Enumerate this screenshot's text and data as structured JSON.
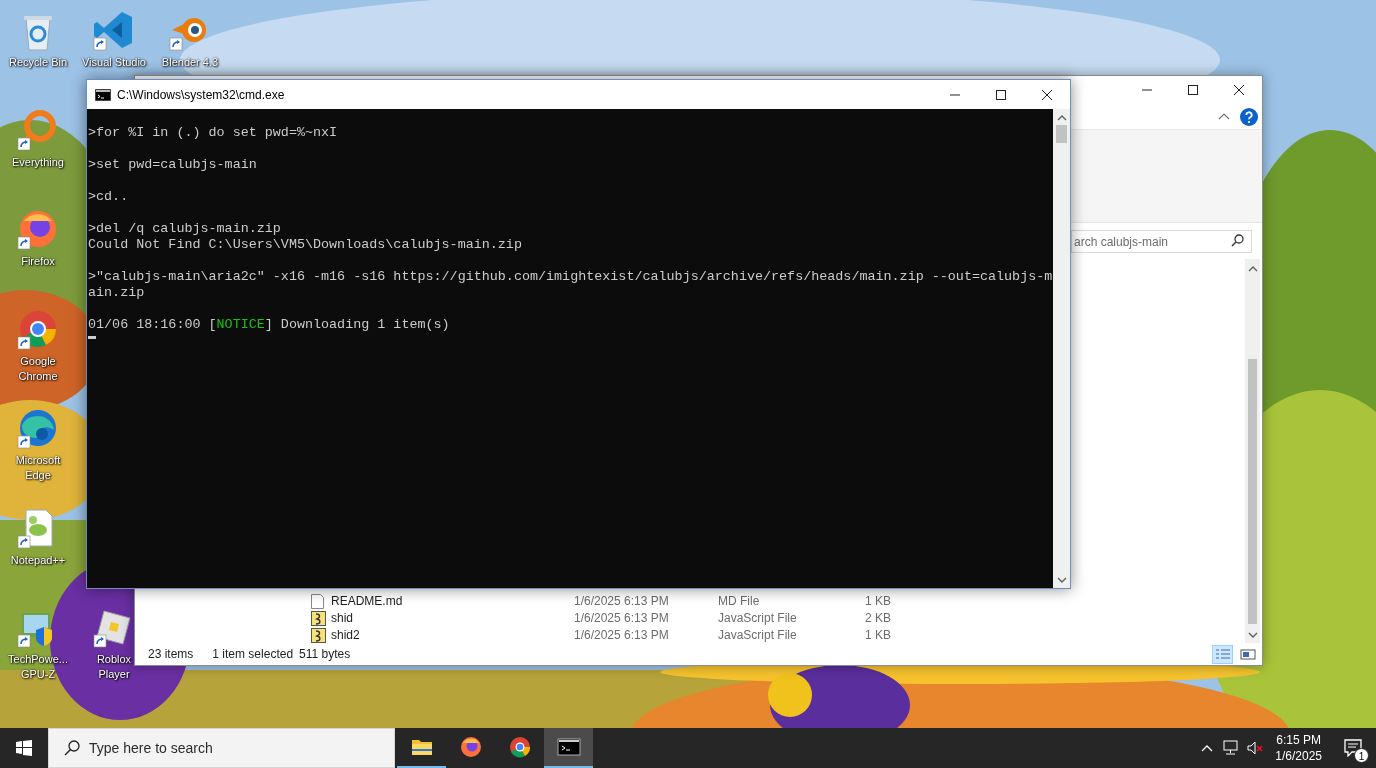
{
  "desktop_icons": [
    {
      "label": "Recycle Bin",
      "kind": "recycle",
      "shortcut": false
    },
    {
      "label": "Visual Studio",
      "kind": "vscode",
      "shortcut": true
    },
    {
      "label": "Blender 4.3",
      "kind": "blender",
      "shortcut": true
    },
    {
      "label": "Everything",
      "kind": "everything",
      "shortcut": true
    },
    {
      "label": "Firefox",
      "kind": "firefox",
      "shortcut": true
    },
    {
      "label": "Google Chrome",
      "kind": "chrome",
      "shortcut": true
    },
    {
      "label": "Microsoft Edge",
      "kind": "edge",
      "shortcut": true
    },
    {
      "label": "Notepad++",
      "kind": "notepad",
      "shortcut": true
    },
    {
      "label": "TechPowe... GPU-Z",
      "kind": "gpuz",
      "shortcut": true
    },
    {
      "label": "Roblox Player",
      "kind": "roblox",
      "shortcut": true
    }
  ],
  "explorer": {
    "search": {
      "placeholder": "arch calubjs-main"
    },
    "files": [
      {
        "name": "README.md",
        "date": "1/6/2025 6:13 PM",
        "type": "MD File",
        "size": "1 KB",
        "kind": "text",
        "selected": false
      },
      {
        "name": "shid",
        "date": "1/6/2025 6:13 PM",
        "type": "JavaScript File",
        "size": "2 KB",
        "kind": "script",
        "selected": false
      },
      {
        "name": "shid2",
        "date": "1/6/2025 6:13 PM",
        "type": "JavaScript File",
        "size": "1 KB",
        "kind": "script",
        "selected": false
      }
    ],
    "status": {
      "count": "23 items",
      "selection": "1 item selected",
      "selection_size": "511 bytes"
    },
    "views": [
      {
        "kind": "details",
        "selected": true
      },
      {
        "kind": "large_icons",
        "selected": false
      }
    ]
  },
  "console": {
    "title": "C:\\Windows\\system32\\cmd.exe",
    "blocks": [
      [
        {
          "text": ">for %I in (.) do set pwd=%~nxI"
        }
      ],
      [
        {
          "text": ">set pwd=calubjs-main"
        }
      ],
      [
        {
          "text": ">cd.."
        }
      ],
      [
        {
          "text": ">del /q calubjs-main.zip"
        },
        {
          "text": "Could Not Find C:\\Users\\VM5\\Downloads\\calubjs-main.zip"
        }
      ],
      [
        {
          "text": ">\"calubjs-main\\aria2c\" -x16 -m16 -s16 https://github.com/imightexist/calubjs/archive/refs/heads/main.zip --out=calubjs-m"
        },
        {
          "text": "ain.zip"
        }
      ],
      [
        {
          "parts": [
            {
              "text": "01/06 18:16:00 ["
            },
            {
              "text": "NOTICE",
              "color": "#16c60c"
            },
            {
              "text": "] Downloading 1 item(s)"
            }
          ]
        }
      ]
    ],
    "cursor": true
  },
  "taskbar": {
    "search": {
      "placeholder": "Type here to search"
    },
    "apps": [
      {
        "kind": "explorer",
        "running": true,
        "selected": false
      },
      {
        "kind": "firefox",
        "running": false,
        "selected": false
      },
      {
        "kind": "chrome",
        "running": false,
        "selected": false
      },
      {
        "kind": "console",
        "running": true,
        "selected": true
      }
    ],
    "volume_muted": true,
    "clock": {
      "time": "6:15 PM",
      "date": "1/6/2025"
    },
    "notifications": {
      "count": "1"
    }
  }
}
